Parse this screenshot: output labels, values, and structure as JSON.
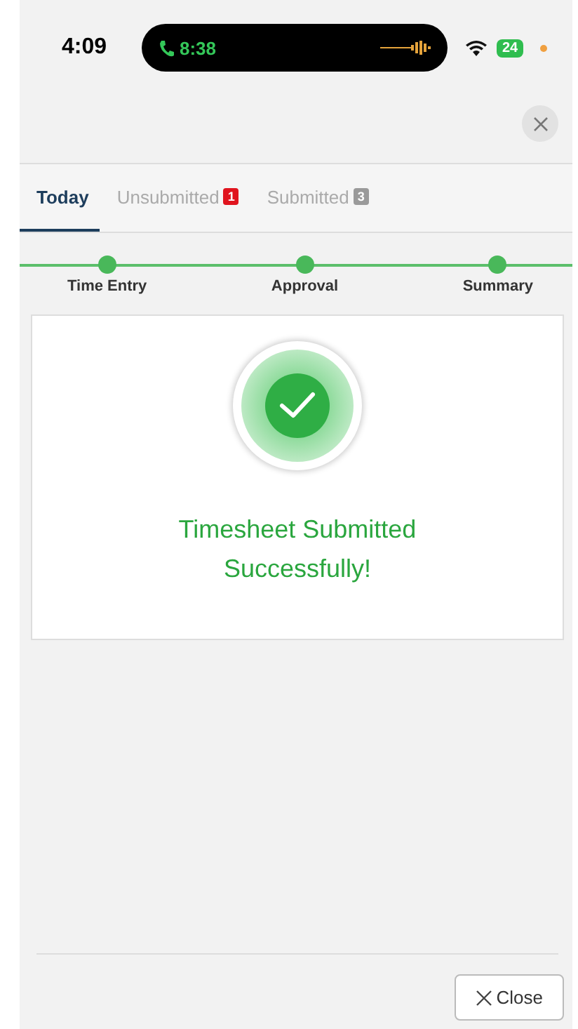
{
  "status_bar": {
    "time": "4:09",
    "call_time": "8:38",
    "battery": "24"
  },
  "tabs": [
    {
      "label": "Today",
      "selected": true
    },
    {
      "label": "Unsubmitted",
      "selected": false,
      "badge": "1",
      "color": "#e0141e"
    },
    {
      "label": "Submitted",
      "selected": false,
      "badge": "3",
      "color": "#9a9a9a"
    }
  ],
  "steps": [
    {
      "label": "Time Entry",
      "completed": true
    },
    {
      "label": "Approval",
      "completed": true
    },
    {
      "label": "Summary",
      "completed": true
    }
  ],
  "message": {
    "title": "Timesheet Submitted Successfully!"
  },
  "footer": {
    "close_button": "Close"
  }
}
